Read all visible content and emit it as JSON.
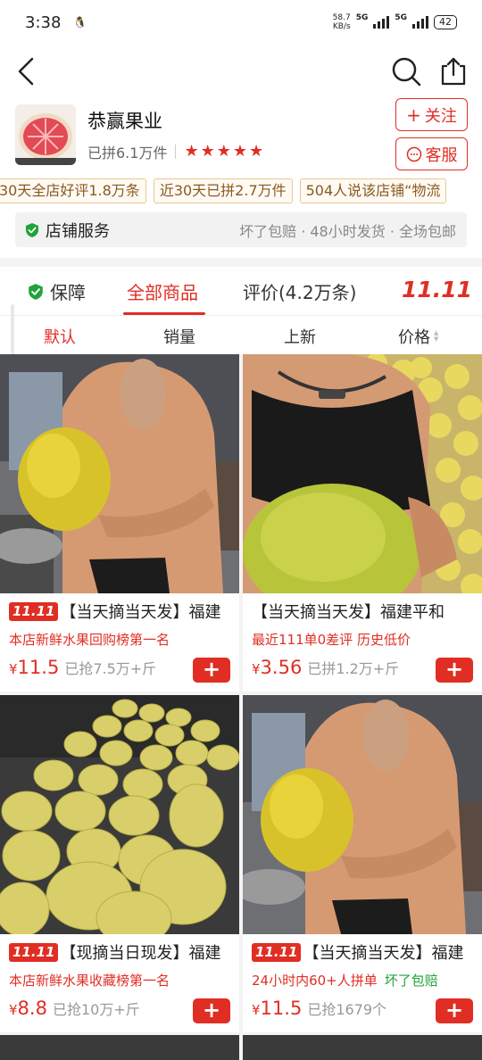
{
  "status_bar": {
    "time": "3:38",
    "speed_top": "58.7",
    "speed_bottom": "KB/s",
    "net1": "5G",
    "net2": "5G",
    "battery": "42"
  },
  "nav": {
    "back_icon": "back-arrow-icon",
    "search_icon": "search-icon",
    "share_icon": "share-icon"
  },
  "shop": {
    "name": "恭赢果业",
    "group_count": "已拼6.1万件",
    "rating_stars": 5,
    "follow_label": "关注",
    "service_label": "客服"
  },
  "tags": [
    "30天全店好评1.8万条",
    "近30天已拼2.7万件",
    "504人说该店铺“物流"
  ],
  "shop_service": {
    "title": "店铺服务",
    "detail": "坏了包赔 · 48小时发货 · 全场包邮"
  },
  "tabs": {
    "guarantee": "保障",
    "all": "全部商品",
    "reviews": "评价(4.2万条)",
    "promo": "11.11"
  },
  "sort": {
    "default": "默认",
    "sales": "销量",
    "new": "上新",
    "price": "价格"
  },
  "badge_text": "11.11",
  "products": [
    {
      "badge": true,
      "title": "【当天摘当天发】福建",
      "sub": "本店新鲜水果回购榜第一名",
      "sub_extra": "",
      "price": "11.5",
      "sold": "已抢7.5万+斤"
    },
    {
      "badge": false,
      "title": "【当天摘当天发】福建平和",
      "sub": "最近111单0差评  历史低价",
      "sub_extra": "",
      "price": "3.56",
      "sold": "已拼1.2万+斤"
    },
    {
      "badge": true,
      "title": "【现摘当日现发】福建",
      "sub": "本店新鲜水果收藏榜第一名",
      "sub_extra": "",
      "price": "8.8",
      "sold": "已抢10万+斤"
    },
    {
      "badge": true,
      "title": "【当天摘当天发】福建",
      "sub": "24小时内60+人拼单",
      "sub_extra": "坏了包赔",
      "price": "11.5",
      "sold": "已抢1679个"
    }
  ],
  "colors": {
    "accent": "#e02e24",
    "green": "#1fa33a",
    "tag_border": "#e9c791"
  }
}
